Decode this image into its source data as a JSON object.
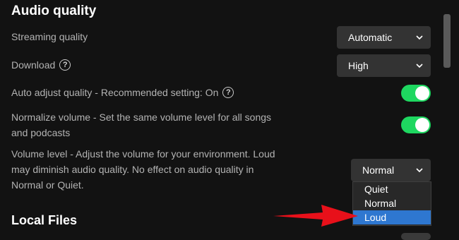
{
  "audio_quality": {
    "heading": "Audio quality",
    "streaming": {
      "label": "Streaming quality",
      "value": "Automatic"
    },
    "download": {
      "label": "Download",
      "value": "High"
    },
    "auto_adjust": {
      "label": "Auto adjust quality - Recommended setting: On",
      "on": true
    },
    "normalize": {
      "label_line1": "Normalize volume - Set the same volume level for all songs",
      "label_line2": "and podcasts",
      "on": true
    },
    "volume_level": {
      "label_line1": "Volume level - Adjust the volume for your environment. Loud",
      "label_line2": "may diminish audio quality. No effect on audio quality in",
      "label_line3": "Normal or Quiet.",
      "value": "Normal",
      "options": [
        "Quiet",
        "Normal",
        "Loud"
      ],
      "highlighted_option": "Loud"
    }
  },
  "local_files": {
    "heading": "Local Files"
  },
  "icons": {
    "help": "?",
    "chevron": "chevron-down-icon"
  },
  "colors": {
    "background": "#121212",
    "toggle_on": "#1ed760",
    "select_bg": "#333333",
    "highlight": "#2e77d0",
    "annotation_arrow": "#e8101a"
  }
}
